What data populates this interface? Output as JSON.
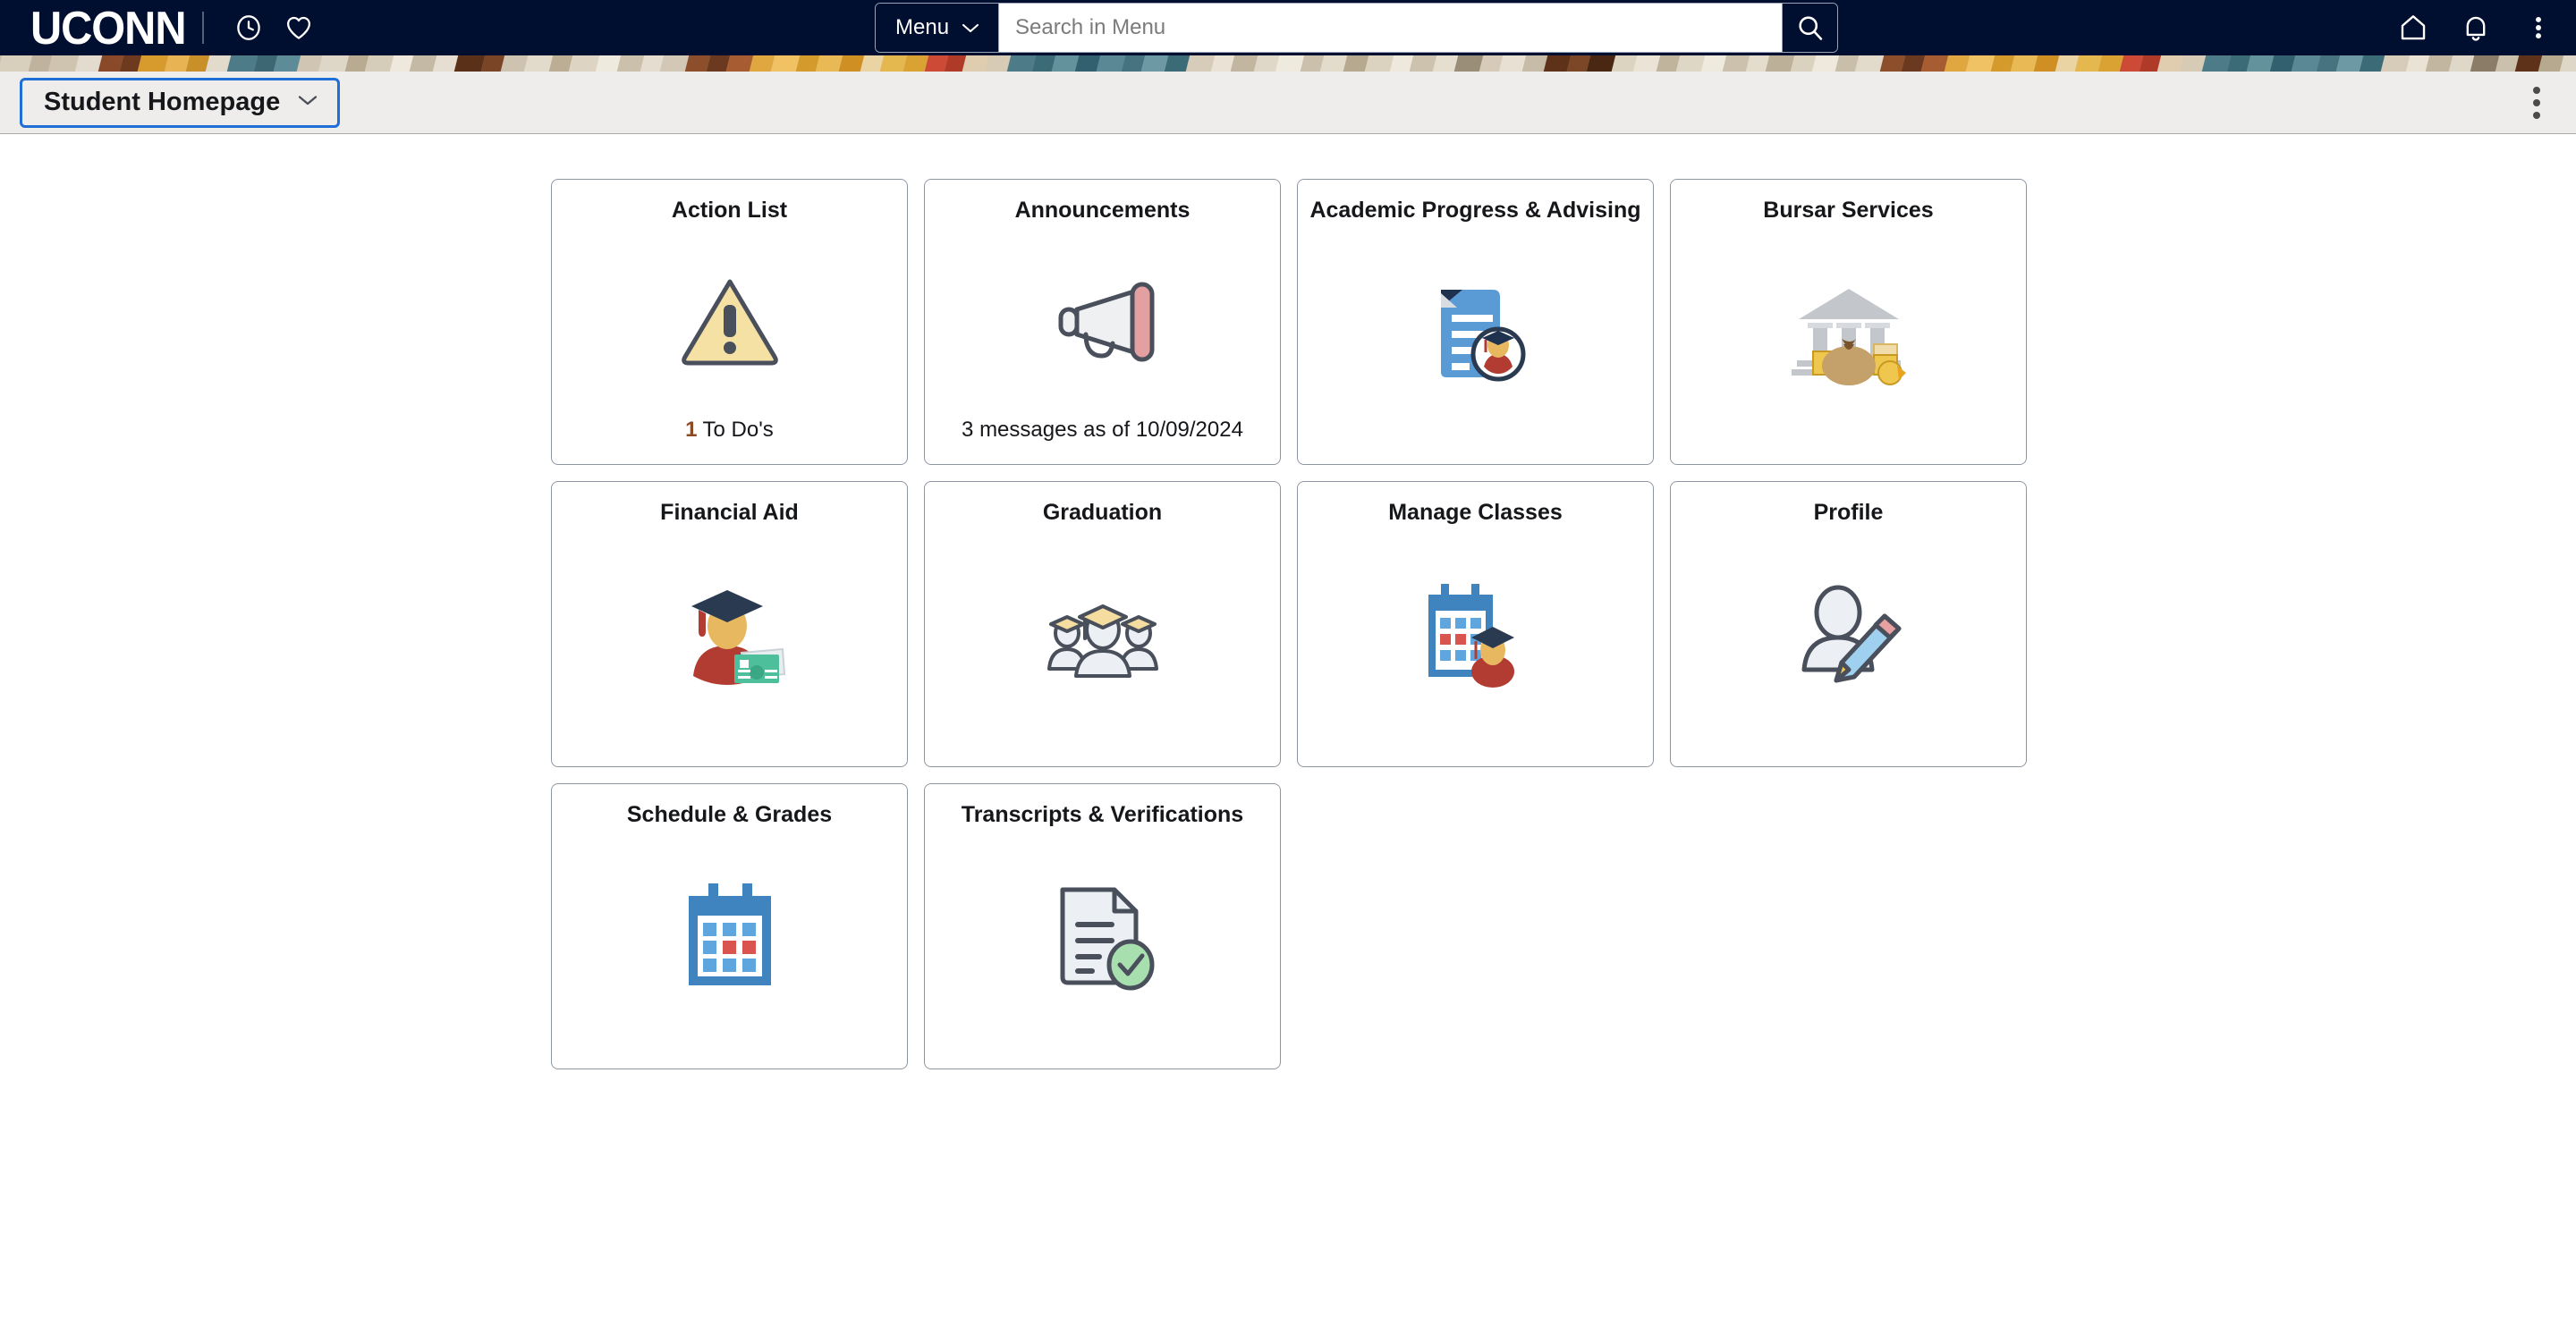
{
  "brand": {
    "logo_text": "UCONN",
    "clock_icon": "clock-icon",
    "favorites_icon": "heart-icon"
  },
  "search": {
    "menu_label": "Menu",
    "menu_chevron_icon": "chevron-down-icon",
    "placeholder": "Search in Menu",
    "value": "",
    "submit_icon": "search-icon"
  },
  "nav_right": {
    "home_icon": "home-icon",
    "notifications_icon": "bell-icon",
    "actions_icon": "kebab-menu-icon"
  },
  "subheader": {
    "homepage_label": "Student Homepage",
    "chevron_icon": "chevron-down-icon",
    "kebab_icon": "kebab-menu-icon",
    "accent_focus_color": "#1f6fd6",
    "background_color": "#eeedeb"
  },
  "theme": {
    "navy": "#000e2f",
    "page_background": "#ffffff",
    "tile_border": "#8f96a3",
    "count_accent": "#8b4a24"
  },
  "tiles": [
    {
      "title": "Action List",
      "icon": "warning-triangle-icon",
      "footer_count": "1",
      "footer_text": "To Do's"
    },
    {
      "title": "Announcements",
      "icon": "megaphone-icon",
      "footer_count": "",
      "footer_text": "3 messages as of 10/09/2024"
    },
    {
      "title": "Academic Progress & Advising",
      "icon": "document-graduate-icon",
      "footer_count": "",
      "footer_text": ""
    },
    {
      "title": "Bursar Services",
      "icon": "bank-money-icon",
      "footer_count": "",
      "footer_text": ""
    },
    {
      "title": "Financial Aid",
      "icon": "graduate-cash-icon",
      "footer_count": "",
      "footer_text": ""
    },
    {
      "title": "Graduation",
      "icon": "graduates-group-icon",
      "footer_count": "",
      "footer_text": ""
    },
    {
      "title": "Manage Classes",
      "icon": "calendar-graduate-icon",
      "footer_count": "",
      "footer_text": ""
    },
    {
      "title": "Profile",
      "icon": "person-pencil-icon",
      "footer_count": "",
      "footer_text": ""
    },
    {
      "title": "Schedule & Grades",
      "icon": "calendar-icon",
      "footer_count": "",
      "footer_text": ""
    },
    {
      "title": "Transcripts & Verifications",
      "icon": "document-check-icon",
      "footer_count": "",
      "footer_text": ""
    }
  ]
}
